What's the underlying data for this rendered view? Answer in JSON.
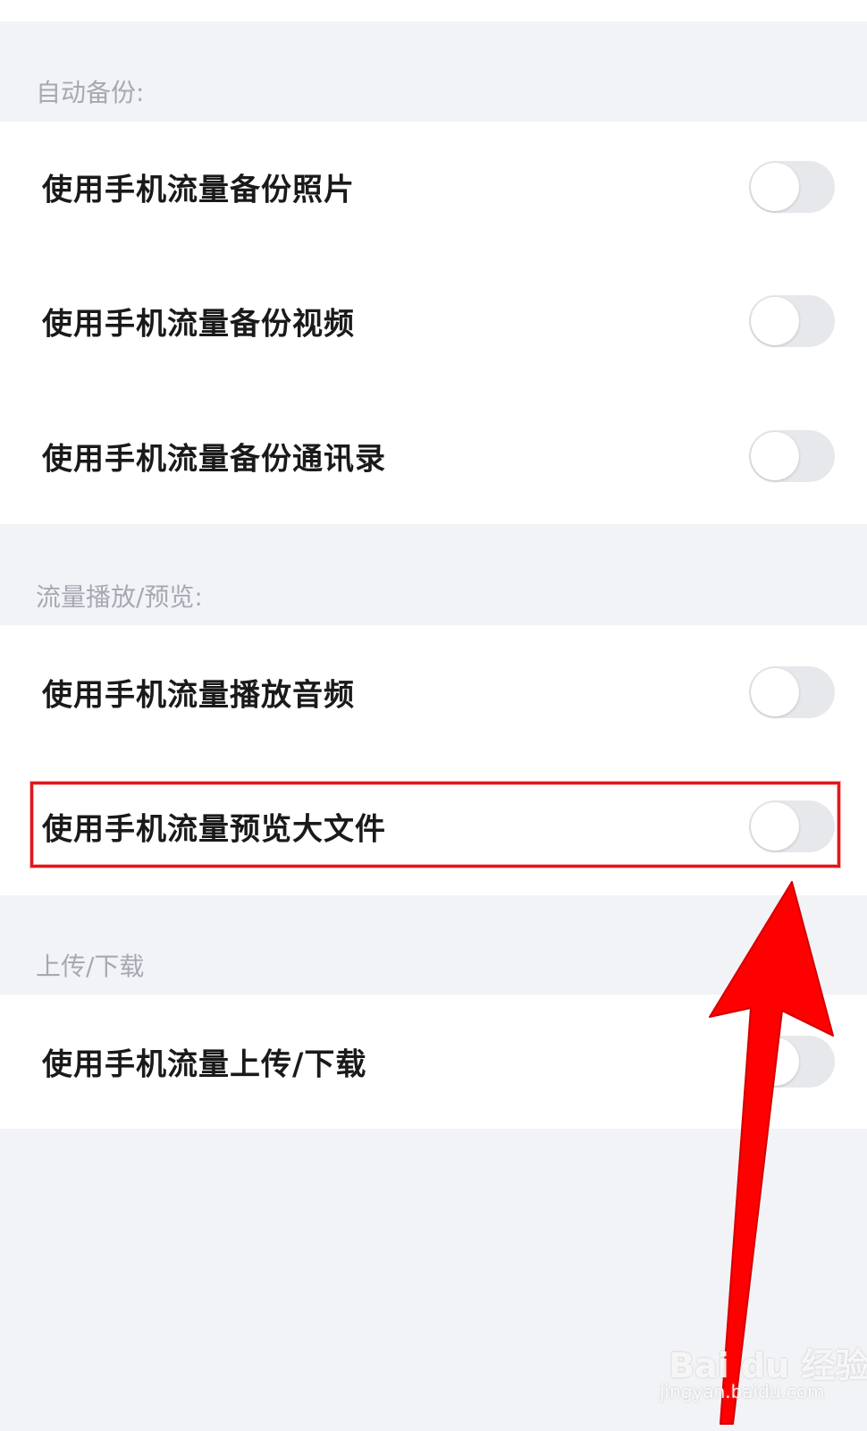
{
  "sections": [
    {
      "header": "自动备份:",
      "rows": [
        {
          "label": "使用手机流量备份照片",
          "switch_on": false
        },
        {
          "label": "使用手机流量备份视频",
          "switch_on": false
        },
        {
          "label": "使用手机流量备份通讯录",
          "switch_on": false
        }
      ]
    },
    {
      "header": "流量播放/预览:",
      "rows": [
        {
          "label": "使用手机流量播放音频",
          "switch_on": false
        },
        {
          "label": "使用手机流量预览大文件",
          "switch_on": false
        }
      ]
    },
    {
      "header": "上传/下载",
      "rows": [
        {
          "label": "使用手机流量上传/下载",
          "switch_on": false
        }
      ]
    }
  ],
  "annotation": {
    "highlight_color": "#e3161b",
    "arrow_color": "#ff0000"
  },
  "watermark": {
    "brand": "Bai du 经验",
    "url": "jingyan.baidu.com"
  }
}
